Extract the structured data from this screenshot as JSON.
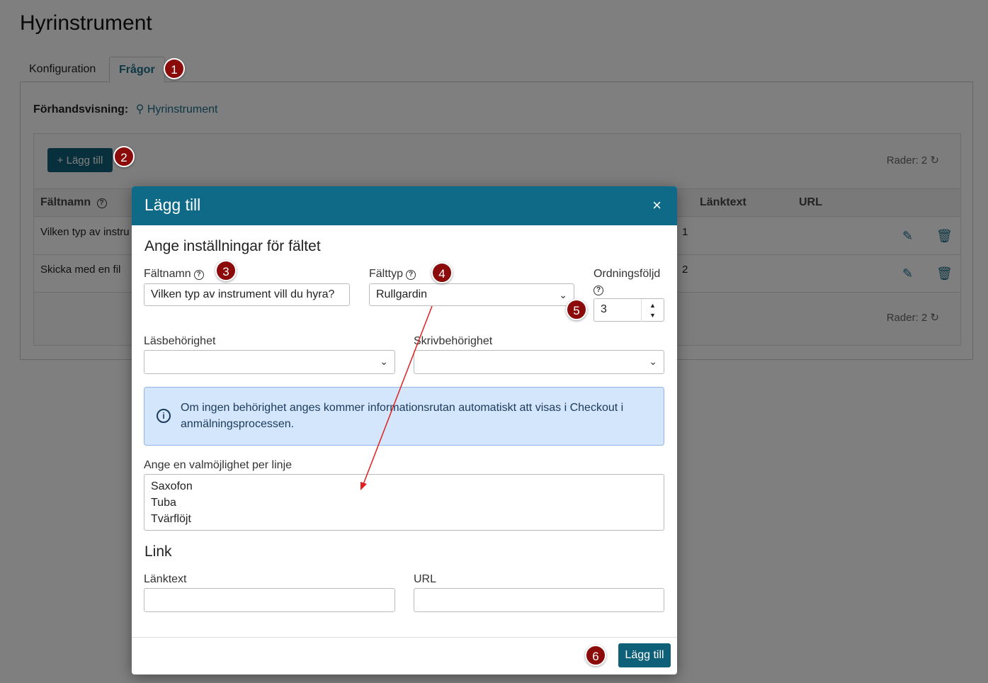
{
  "page": {
    "title": "Hyrinstrument"
  },
  "tabs": [
    {
      "label": "Konfiguration"
    },
    {
      "label": "Frågor"
    }
  ],
  "preview": {
    "label": "Förhandsvisning:",
    "link": "Hyrinstrument"
  },
  "grid": {
    "add_label": "+ Lägg till",
    "rows_count": "Rader: 2",
    "columns": [
      "Fältnamn",
      "Länktext",
      "URL"
    ],
    "rows": [
      {
        "name": "Vilken typ av instru",
        "order": "1"
      },
      {
        "name": "Skicka med en fil",
        "order": "2"
      }
    ]
  },
  "modal": {
    "title": "Lägg till",
    "close": "×",
    "section1": "Ange inställningar för fältet",
    "field_name_label": "Fältnamn",
    "field_name_value": "Vilken typ av instrument vill du hyra?",
    "field_type_label": "Fälttyp",
    "field_type_value": "Rullgardin",
    "order_label": "Ordningsföljd",
    "order_value": "3",
    "read_label": "Läsbehörighet",
    "write_label": "Skrivbehörighet",
    "info_text": "Om ingen behörighet anges kommer informationsrutan automatiskt att visas i Checkout i anmälningsprocessen.",
    "options_label": "Ange en valmöjlighet per linje",
    "options": [
      "Saxofon",
      "Tuba",
      "Tvärflöjt"
    ],
    "section2": "Link",
    "linktext_label": "Länktext",
    "url_label": "URL",
    "submit_label": "Lägg till"
  },
  "badges": [
    "1",
    "2",
    "3",
    "4",
    "5",
    "6"
  ],
  "colors": {
    "primary": "#0e6a87",
    "badge": "#8b0a0a",
    "info_bg": "#d4e6fb",
    "arrow": "#e02020"
  }
}
